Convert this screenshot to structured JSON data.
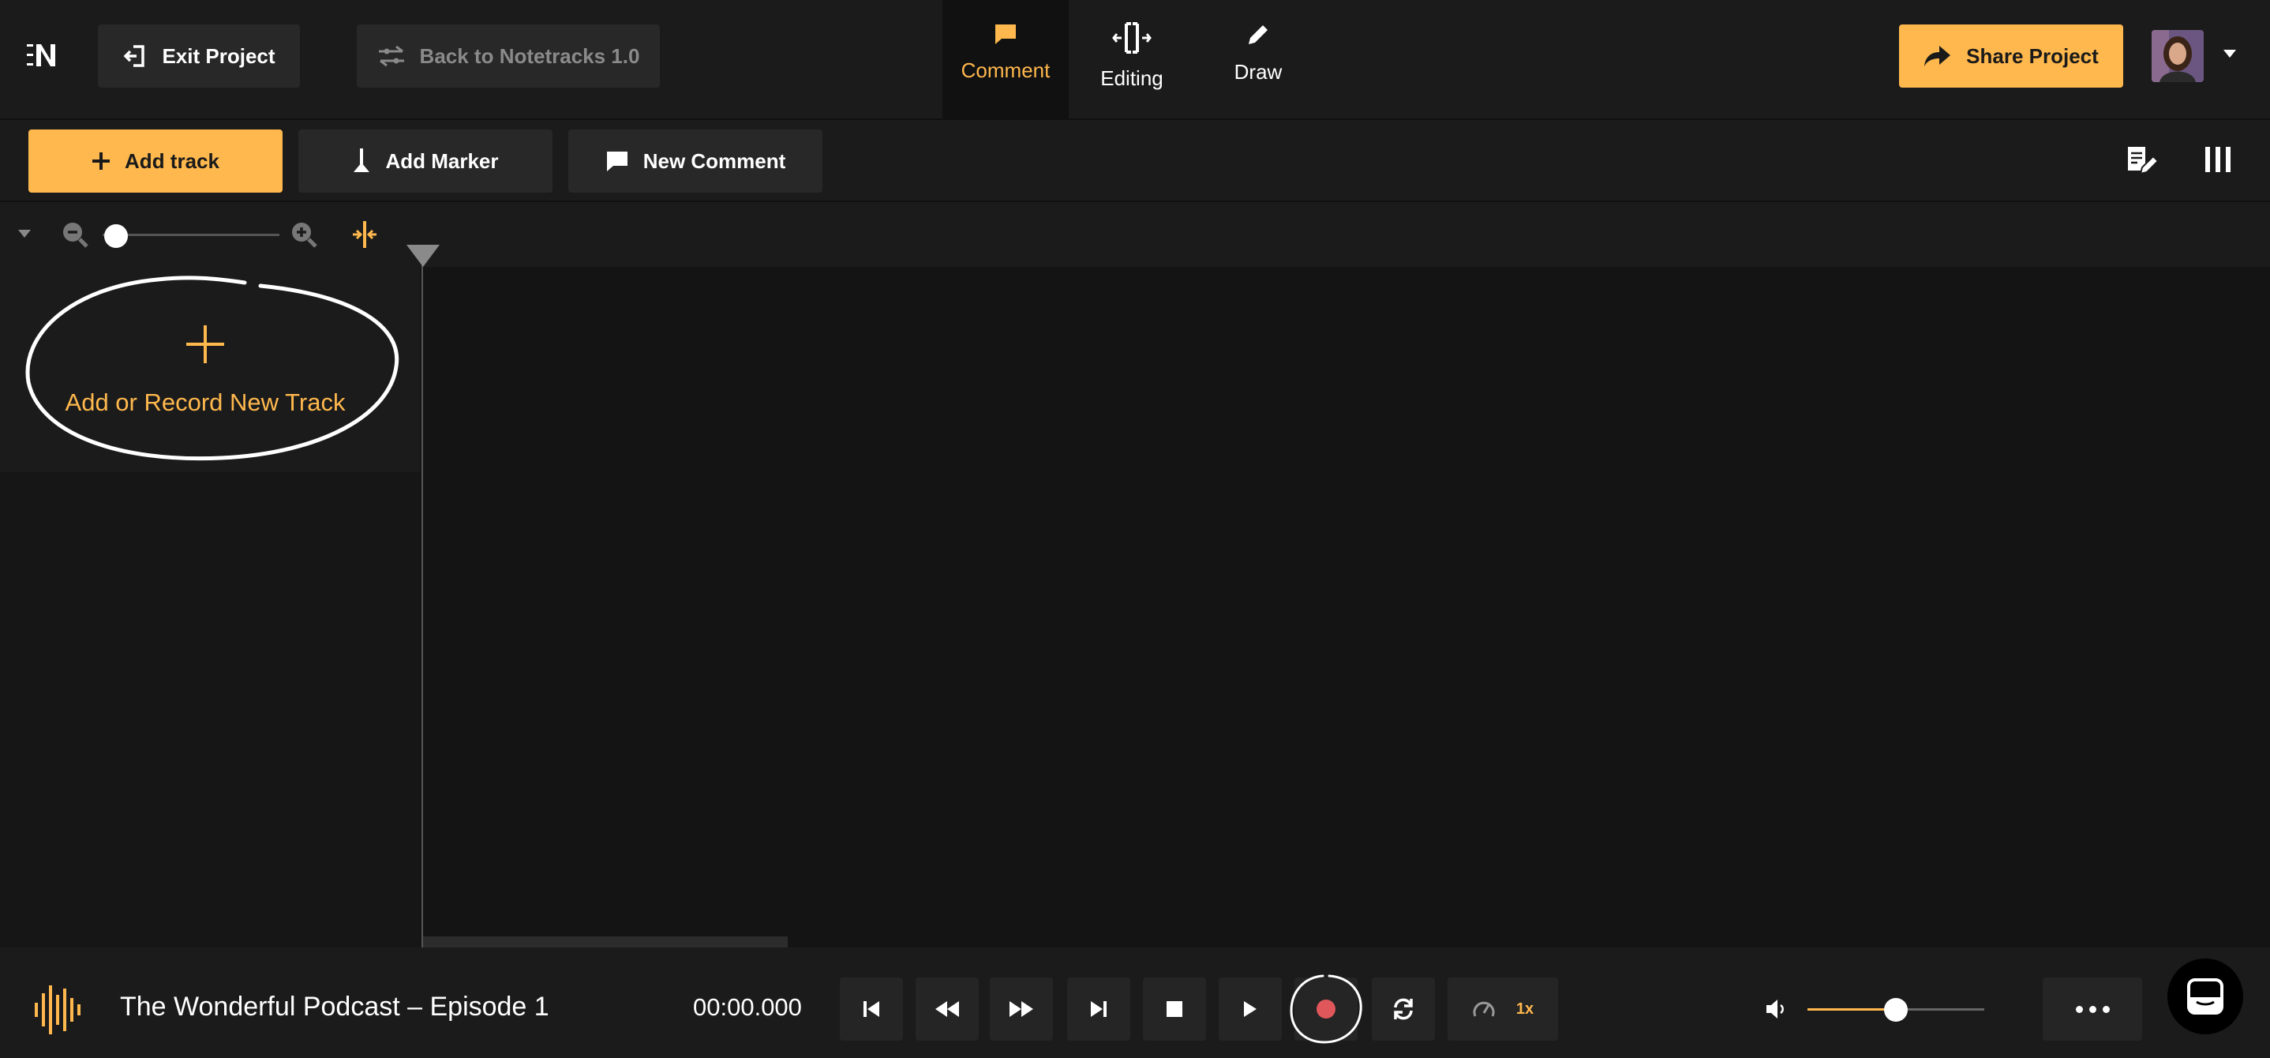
{
  "header": {
    "exit_label": "Exit Project",
    "back_label": "Back to Notetracks 1.0",
    "modes": [
      {
        "label": "Comment",
        "active": true
      },
      {
        "label": "Editing",
        "active": false
      },
      {
        "label": "Draw",
        "active": false
      }
    ],
    "share_label": "Share Project"
  },
  "toolbar": {
    "add_track_label": "Add track",
    "add_marker_label": "Add Marker",
    "new_comment_label": "New Comment"
  },
  "track_panel": {
    "add_track_prompt": "Add or Record New Track"
  },
  "player": {
    "title": "The Wonderful Podcast – Episode 1",
    "timecode": "00:00.000",
    "speed": "1x",
    "volume_fraction": 0.5
  },
  "colors": {
    "accent": "#ffb84d",
    "background": "#141414",
    "panel": "#1b1b1b",
    "button": "#282828",
    "record": "#e0575b"
  }
}
